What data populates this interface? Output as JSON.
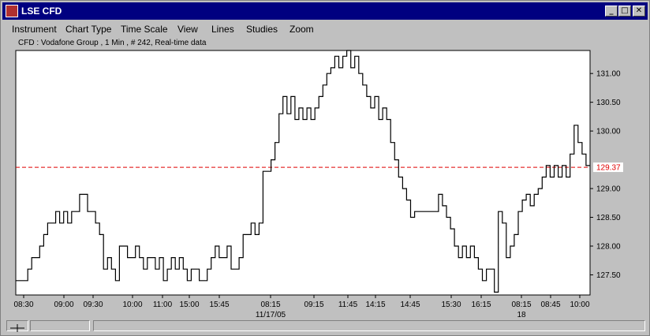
{
  "window": {
    "title": "LSE CFD",
    "minimize_label": "_",
    "maximize_label": "□",
    "close_label": "✕"
  },
  "menu": [
    "Instrument",
    "Chart Type",
    "Time Scale",
    "View",
    "Lines",
    "Studies",
    "Zoom"
  ],
  "chart_info": "CFD : Vodafone Group , 1 Min , # 242, Real-time data",
  "colors": {
    "titlebar": "#000080",
    "reference_line": "#e00000"
  },
  "icons": {
    "app": "app-icon",
    "status": "crosshair-icon"
  },
  "chart_data": {
    "type": "line",
    "style": "step",
    "x_ticks": [
      "08:30",
      "09:00",
      "09:30",
      "10:00",
      "11:00",
      "15:00",
      "15:45",
      "08:15",
      "09:15",
      "11:45",
      "14:15",
      "14:45",
      "15:30",
      "16:15",
      "08:15",
      "08:45",
      "10:00"
    ],
    "x_date_labels": [
      {
        "after_tick": "08:15",
        "label": "11/17/05"
      },
      {
        "after_tick": "16:15",
        "label": "18"
      }
    ],
    "y_ticks": [
      "131.00",
      "130.50",
      "130.00",
      "129.00",
      "128.50",
      "128.00",
      "127.50"
    ],
    "ylim": [
      127.15,
      131.4
    ],
    "reference_line": {
      "value": 129.37,
      "label": "129.37",
      "style": "dashed"
    },
    "series": [
      {
        "values": [
          127.4,
          127.4,
          127.4,
          127.6,
          127.8,
          127.8,
          128.0,
          128.2,
          128.4,
          128.4,
          128.6,
          128.4,
          128.6,
          128.4,
          128.6,
          128.6,
          128.9,
          128.9,
          128.6,
          128.6,
          128.4,
          128.2,
          127.6,
          127.8,
          127.6,
          127.4,
          128.0,
          128.0,
          127.8,
          127.8,
          128.0,
          127.8,
          127.6,
          127.8,
          127.8,
          127.6,
          127.8,
          127.4,
          127.6,
          127.8,
          127.6,
          127.8,
          127.6,
          127.4,
          127.6,
          127.6,
          127.4,
          127.4,
          127.6,
          127.8,
          128.0,
          127.8,
          127.8,
          128.0,
          127.6,
          127.6,
          127.8,
          128.2,
          128.2,
          128.4,
          128.2,
          128.4,
          129.3,
          129.3,
          129.5,
          129.8,
          130.3,
          130.6,
          130.3,
          130.6,
          130.2,
          130.4,
          130.2,
          130.4,
          130.2,
          130.4,
          130.6,
          130.8,
          131.0,
          131.1,
          131.3,
          131.1,
          131.3,
          131.4,
          131.1,
          131.3,
          131.0,
          130.8,
          130.6,
          130.4,
          130.6,
          130.2,
          130.4,
          130.2,
          129.8,
          129.5,
          129.2,
          129.0,
          128.8,
          128.5,
          128.6,
          128.6,
          128.6,
          128.6,
          128.6,
          128.6,
          128.9,
          128.7,
          128.5,
          128.3,
          128.0,
          127.8,
          128.0,
          127.8,
          128.0,
          127.8,
          127.6,
          127.4,
          127.6,
          127.6,
          127.2,
          128.6,
          128.4,
          127.8,
          128.0,
          128.2,
          128.6,
          128.8,
          128.9,
          128.7,
          128.9,
          129.0,
          129.2,
          129.4,
          129.2,
          129.4,
          129.2,
          129.4,
          129.2,
          129.6,
          130.1,
          129.8,
          129.6,
          129.4
        ]
      }
    ]
  }
}
